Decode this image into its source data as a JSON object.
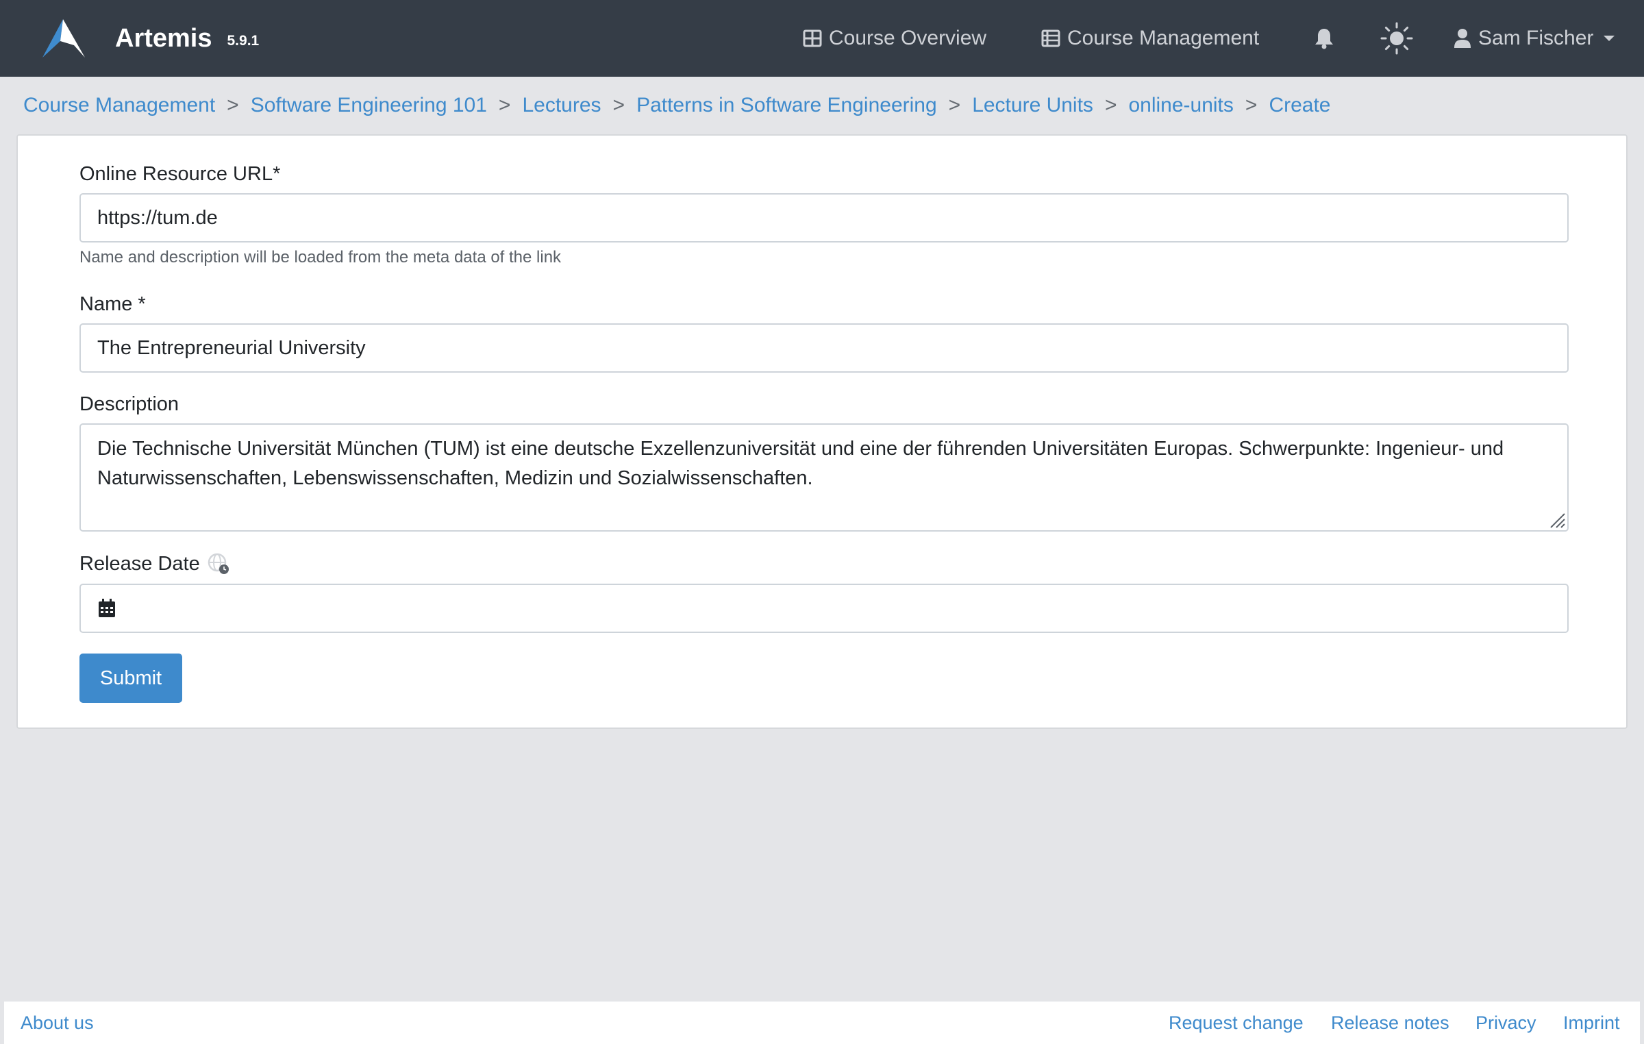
{
  "navbar": {
    "brand_name": "Artemis",
    "version": "5.9.1",
    "links": {
      "course_overview": "Course Overview",
      "course_management": "Course Management"
    },
    "user_name": "Sam Fischer",
    "icons": {
      "logo": "artemis-logo",
      "overview": "grid-icon",
      "management": "table-list-icon",
      "notifications": "bell-icon",
      "theme": "sun-icon",
      "user": "user-icon",
      "dropdown": "caret-down-icon"
    }
  },
  "breadcrumb": {
    "items": [
      "Course Management",
      "Software Engineering 101",
      "Lectures",
      "Patterns in Software Engineering",
      "Lecture Units",
      "online-units",
      "Create"
    ],
    "separator": ">"
  },
  "form": {
    "url_label": "Online Resource URL*",
    "url_value": "https://tum.de",
    "url_help": "Name and description will be loaded from the meta data of the link",
    "name_label": "Name *",
    "name_value": "The Entrepreneurial University",
    "description_label": "Description",
    "description_value": "Die Technische Universität München (TUM) ist eine deutsche Exzellenzuniversität und eine der führenden Universitäten Europas. Schwerpunkte: Ingenieur- und Naturwissenschaften, Lebenswissenschaften, Medizin und Sozialwissenschaften.",
    "release_date_label": "Release Date",
    "release_date_value": "",
    "submit_label": "Submit"
  },
  "footer": {
    "about": "About us",
    "request_change": "Request change",
    "release_notes": "Release notes",
    "privacy": "Privacy",
    "imprint": "Imprint"
  },
  "colors": {
    "navbar_bg": "#353d47",
    "accent": "#3e8acc",
    "page_bg": "#e4e5e8"
  }
}
